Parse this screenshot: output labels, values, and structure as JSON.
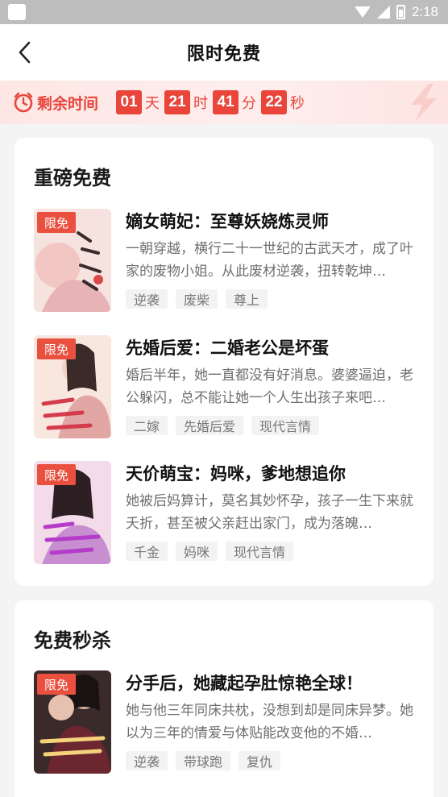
{
  "status_bar": {
    "time": "2:18"
  },
  "header": {
    "title": "限时免费"
  },
  "countdown": {
    "label": "剩余时间",
    "days": "01",
    "days_unit": "天",
    "hours": "21",
    "hours_unit": "时",
    "minutes": "41",
    "minutes_unit": "分",
    "seconds": "22",
    "seconds_unit": "秒"
  },
  "sections": [
    {
      "title": "重磅免费",
      "books": [
        {
          "badge": "限免",
          "title": "嫡女萌妃：至尊妖娆炼灵师",
          "description": "一朝穿越，横行二十一世纪的古武天才，成了叶家的废物小姐。从此废材逆袭，扭转乾坤…",
          "tags": [
            "逆袭",
            "废柴",
            "尊上"
          ],
          "cover_color": "#f6e3e0"
        },
        {
          "badge": "限免",
          "title": "先婚后爱：二婚老公是坏蛋",
          "description": "婚后半年，她一直都没有好消息。婆婆逼迫，老公躲闪，总不能让她一个人生出孩子来吧…",
          "tags": [
            "二嫁",
            "先婚后爱",
            "现代言情"
          ],
          "cover_color": "#f8e7df"
        },
        {
          "badge": "限免",
          "title": "天价萌宝：妈咪，爹地想追你",
          "description": "她被后妈算计，莫名其妙怀孕，孩子一生下来就夭折，甚至被父亲赶出家门，成为落魄…",
          "tags": [
            "千金",
            "妈咪",
            "现代言情"
          ],
          "cover_color": "#f3dbe9"
        }
      ]
    },
    {
      "title": "免费秒杀",
      "books": [
        {
          "badge": "限免",
          "title": "分手后，她藏起孕肚惊艳全球！",
          "description": "她与他三年同床共枕，没想到却是同床异梦。她以为三年的情爱与体贴能改变他的不婚…",
          "tags": [
            "逆袭",
            "带球跑",
            "复仇"
          ],
          "cover_color": "#3a2a2a"
        }
      ]
    }
  ],
  "colors": {
    "accent": "#e9453a",
    "badge": "#e9503f"
  }
}
